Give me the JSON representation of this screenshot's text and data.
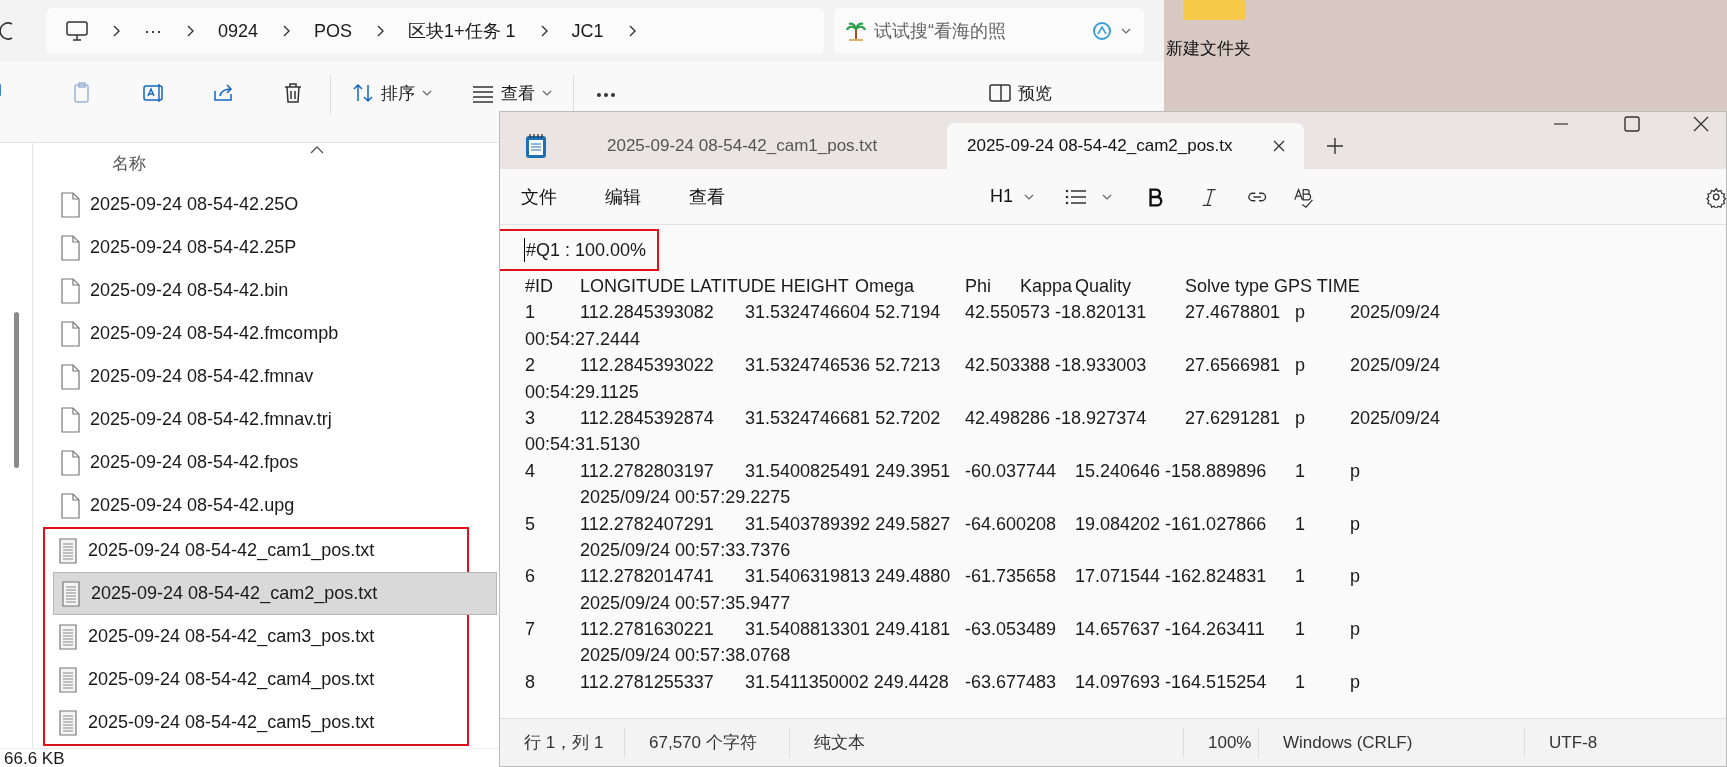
{
  "explorer": {
    "breadcrumb_overflow": "···",
    "breadcrumb": [
      "0924",
      "POS",
      "区块1+任务 1",
      "JC1"
    ],
    "search": {
      "placeholder": "试试搜“看海的照"
    },
    "toolbar": {
      "sort": "排序",
      "view": "查看",
      "preview": "预览"
    },
    "column_header": "名称",
    "files": [
      {
        "name": "2025-09-24 08-54-42.25O",
        "kind": "file",
        "selected": false,
        "marked": false
      },
      {
        "name": "2025-09-24 08-54-42.25P",
        "kind": "file",
        "selected": false,
        "marked": false
      },
      {
        "name": "2025-09-24 08-54-42.bin",
        "kind": "file",
        "selected": false,
        "marked": false
      },
      {
        "name": "2025-09-24 08-54-42.fmcompb",
        "kind": "file",
        "selected": false,
        "marked": false
      },
      {
        "name": "2025-09-24 08-54-42.fmnav",
        "kind": "file",
        "selected": false,
        "marked": false
      },
      {
        "name": "2025-09-24 08-54-42.fmnav.trj",
        "kind": "file",
        "selected": false,
        "marked": false
      },
      {
        "name": "2025-09-24 08-54-42.fpos",
        "kind": "file",
        "selected": false,
        "marked": false
      },
      {
        "name": "2025-09-24 08-54-42.upg",
        "kind": "file",
        "selected": false,
        "marked": false
      },
      {
        "name": "2025-09-24 08-54-42_cam1_pos.txt",
        "kind": "text",
        "selected": false,
        "marked": true
      },
      {
        "name": "2025-09-24 08-54-42_cam2_pos.txt",
        "kind": "text",
        "selected": true,
        "marked": true
      },
      {
        "name": "2025-09-24 08-54-42_cam3_pos.txt",
        "kind": "text",
        "selected": false,
        "marked": true
      },
      {
        "name": "2025-09-24 08-54-42_cam4_pos.txt",
        "kind": "text",
        "selected": false,
        "marked": true
      },
      {
        "name": "2025-09-24 08-54-42_cam5_pos.txt",
        "kind": "text",
        "selected": false,
        "marked": true
      }
    ],
    "status": "66.6 KB"
  },
  "desktop": {
    "folder_label": "新建文件夹"
  },
  "notepad": {
    "tabs": [
      {
        "label": "2025-09-24 08-54-42_cam1_pos.txt",
        "selected": false
      },
      {
        "label": "2025-09-24 08-54-42_cam2_pos.tx",
        "selected": true
      }
    ],
    "menu": [
      "文件",
      "编辑",
      "查看"
    ],
    "heading": "H1",
    "lines": [
      {
        "text": "#Q1 : 100.00%",
        "marked": true
      },
      {
        "text": "#ID\tLONGITUDE\tLATITUDE HEIGHT\tOmega\tPhi\tKappa\tQuality\tSolve type GPS TIME",
        "marked": false
      },
      {
        "text": "1\t112.2845393082\t31.5324746604 52.7194\t42.550573 -18.820131\t27.4678801\tp\t2025/09/24",
        "marked": false
      },
      {
        "text": "00:54:27.2444",
        "marked": false
      },
      {
        "text": "2\t112.2845393022\t31.5324746536 52.7213\t42.503388 -18.933003\t27.6566981\tp\t2025/09/24",
        "marked": false
      },
      {
        "text": "00:54:29.1125",
        "marked": false
      },
      {
        "text": "3\t112.2845392874\t31.5324746681 52.7202\t42.498286 -18.927374\t27.6291281\tp\t2025/09/24",
        "marked": false
      },
      {
        "text": "00:54:31.5130",
        "marked": false
      },
      {
        "text": "4\t112.2782803197\t31.5400825491 249.3951\t-60.037744\t15.240646 -158.889896\t1\tp",
        "marked": false
      },
      {
        "text": "\t2025/09/24 00:57:29.2275",
        "marked": false
      },
      {
        "text": "5\t112.2782407291\t31.5403789392 249.5827\t-64.600208\t19.084202 -161.027866\t1\tp",
        "marked": false
      },
      {
        "text": "\t2025/09/24 00:57:33.7376",
        "marked": false
      },
      {
        "text": "6\t112.2782014741\t31.5406319813 249.4880\t-61.735658\t17.071544 -162.824831\t1\tp",
        "marked": false
      },
      {
        "text": "\t2025/09/24 00:57:35.9477",
        "marked": false
      },
      {
        "text": "7\t112.2781630221\t31.5408813301 249.4181\t-63.053489\t14.657637 -164.263411\t1\tp",
        "marked": false
      },
      {
        "text": "\t2025/09/24 00:57:38.0768",
        "marked": false
      },
      {
        "text": "8\t112.2781255337\t31.5411350002 249.4428\t-63.677483\t14.097693 -164.515254\t1\tp",
        "marked": false
      }
    ],
    "status": [
      "行 1，列 1",
      "67,570 个字符",
      "纯文本",
      "100%",
      "Windows (CRLF)",
      "UTF-8"
    ]
  }
}
